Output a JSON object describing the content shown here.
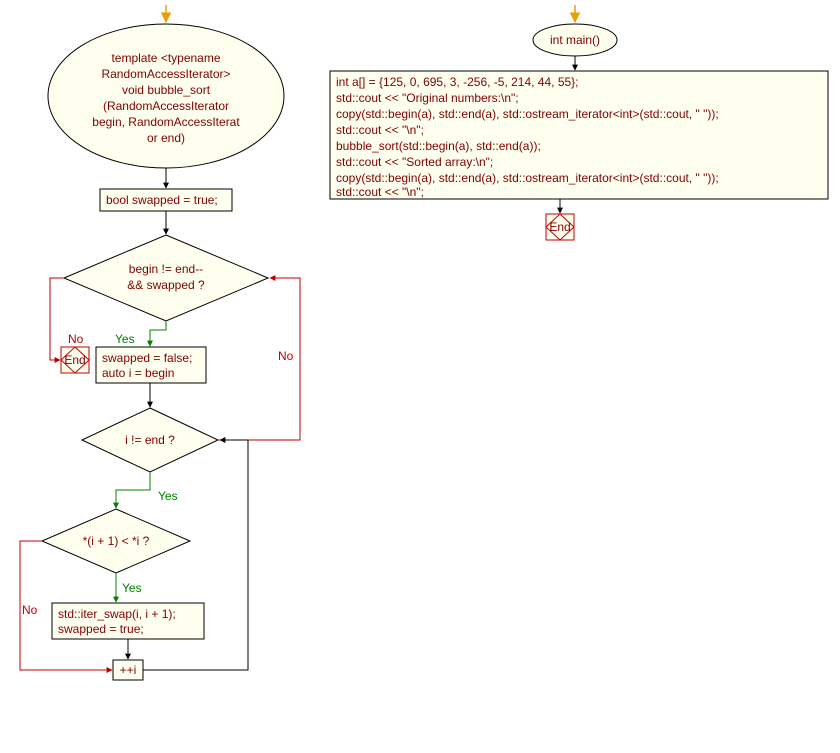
{
  "left": {
    "func_sig": {
      "l1": "template <typename",
      "l2": "RandomAccessIterator>",
      "l3": "void bubble_sort",
      "l4": "(RandomAccessIterator",
      "l5": "begin, RandomAccessIterat",
      "l6": "or end)"
    },
    "init": "bool swapped = true;",
    "outer_cond": {
      "l1": "begin != end--",
      "l2": "&& swapped ?"
    },
    "end1": "End",
    "outer_body": {
      "l1": "swapped = false;",
      "l2": "auto i = begin"
    },
    "inner_cond": "i != end ?",
    "swap_cond": "*(i + 1) < *i ?",
    "swap_body": {
      "l1": "std::iter_swap(i, i + 1);",
      "l2": "swapped = true;"
    },
    "inc": "++i"
  },
  "right": {
    "main": "int main()",
    "body": {
      "l1": "int a[] = {125, 0, 695, 3, -256, -5, 214, 44, 55};",
      "l2": "std::cout << \"Original numbers:\\n\";",
      "l3": "copy(std::begin(a), std::end(a), std::ostream_iterator<int>(std::cout, \" \"));",
      "l4": "std::cout << \"\\n\";",
      "l5": "bubble_sort(std::begin(a), std::end(a));",
      "l6": "std::cout << \"Sorted array:\\n\";",
      "l7": "copy(std::begin(a), std::end(a), std::ostream_iterator<int>(std::cout, \" \"));",
      "l8": "std::cout << \"\\n\";"
    },
    "end": "End"
  },
  "labels": {
    "yes": "Yes",
    "no": "No"
  },
  "chart_data": {
    "type": "flowchart",
    "charts": [
      {
        "name": "bubble_sort",
        "nodes": [
          {
            "id": "start1",
            "type": "entry-arrow"
          },
          {
            "id": "sig",
            "type": "terminator",
            "text": "template <typename RandomAccessIterator> void bubble_sort (RandomAccessIterator begin, RandomAccessIterator end)"
          },
          {
            "id": "init",
            "type": "process",
            "text": "bool swapped = true;"
          },
          {
            "id": "outer_cond",
            "type": "decision",
            "text": "begin != end-- && swapped ?"
          },
          {
            "id": "end1",
            "type": "terminator",
            "text": "End"
          },
          {
            "id": "outer_body",
            "type": "process",
            "text": "swapped = false; auto i = begin"
          },
          {
            "id": "inner_cond",
            "type": "decision",
            "text": "i != end ?"
          },
          {
            "id": "swap_cond",
            "type": "decision",
            "text": "*(i + 1) < *i ?"
          },
          {
            "id": "swap_body",
            "type": "process",
            "text": "std::iter_swap(i, i + 1); swapped = true;"
          },
          {
            "id": "inc",
            "type": "process",
            "text": "++i"
          }
        ],
        "edges": [
          {
            "from": "start1",
            "to": "sig"
          },
          {
            "from": "sig",
            "to": "init"
          },
          {
            "from": "init",
            "to": "outer_cond"
          },
          {
            "from": "outer_cond",
            "to": "end1",
            "label": "No"
          },
          {
            "from": "outer_cond",
            "to": "outer_body",
            "label": "Yes"
          },
          {
            "from": "outer_body",
            "to": "inner_cond"
          },
          {
            "from": "inner_cond",
            "to": "swap_cond",
            "label": "Yes"
          },
          {
            "from": "inner_cond",
            "to": "outer_cond",
            "label": "No"
          },
          {
            "from": "swap_cond",
            "to": "swap_body",
            "label": "Yes"
          },
          {
            "from": "swap_cond",
            "to": "inc",
            "label": "No"
          },
          {
            "from": "swap_body",
            "to": "inc"
          },
          {
            "from": "inc",
            "to": "inner_cond"
          }
        ]
      },
      {
        "name": "main",
        "nodes": [
          {
            "id": "start2",
            "type": "entry-arrow"
          },
          {
            "id": "main_sig",
            "type": "terminator",
            "text": "int main()"
          },
          {
            "id": "main_body",
            "type": "process",
            "text": "int a[] = {125, 0, 695, 3, -256, -5, 214, 44, 55}; std::cout << \"Original numbers:\\n\"; copy(std::begin(a), std::end(a), std::ostream_iterator<int>(std::cout, \" \")); std::cout << \"\\n\"; bubble_sort(std::begin(a), std::end(a)); std::cout << \"Sorted array:\\n\"; copy(std::begin(a), std::end(a), std::ostream_iterator<int>(std::cout, \" \")); std::cout << \"\\n\";"
          },
          {
            "id": "end2",
            "type": "terminator",
            "text": "End"
          }
        ],
        "edges": [
          {
            "from": "start2",
            "to": "main_sig"
          },
          {
            "from": "main_sig",
            "to": "main_body"
          },
          {
            "from": "main_body",
            "to": "end2"
          }
        ]
      }
    ]
  }
}
